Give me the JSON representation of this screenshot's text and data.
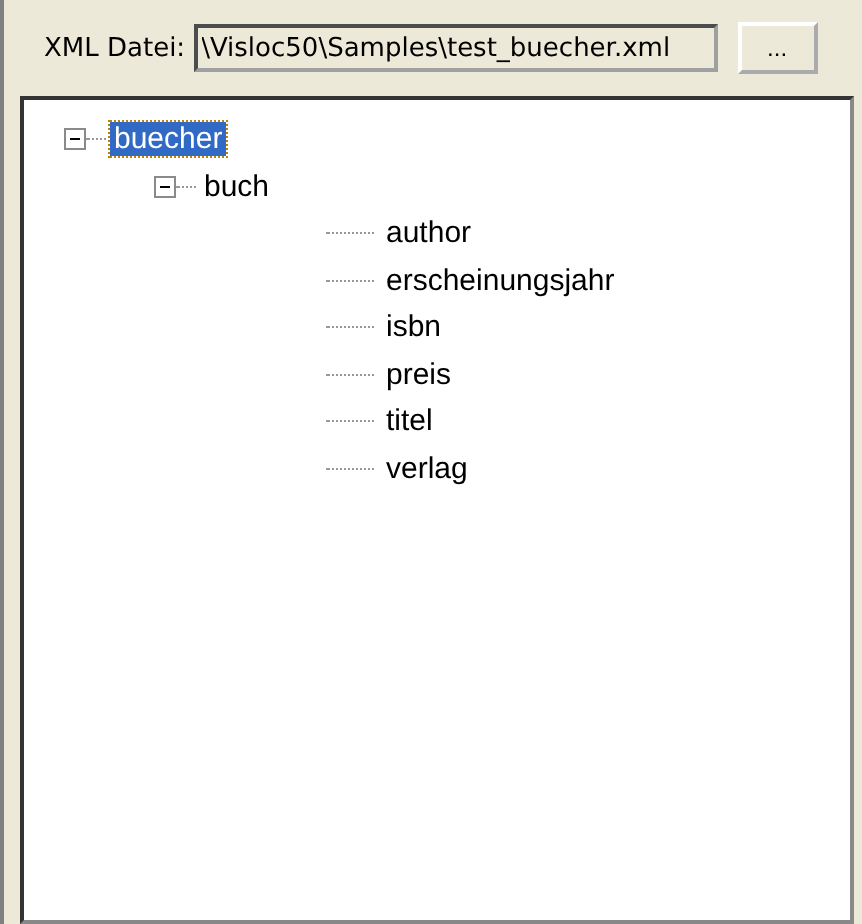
{
  "file_bar": {
    "label": "XML Datei:",
    "value": "\\Visloc50\\Samples\\test_buecher.xml",
    "browse_button": "..."
  },
  "tree": [
    {
      "label": "buecher",
      "selected": true,
      "expanded": true,
      "children": [
        {
          "label": "buch",
          "selected": false,
          "expanded": true,
          "children": [
            {
              "label": "author",
              "selected": false
            },
            {
              "label": "erscheinungsjahr",
              "selected": false
            },
            {
              "label": "isbn",
              "selected": false
            },
            {
              "label": "preis",
              "selected": false
            },
            {
              "label": "titel",
              "selected": false
            },
            {
              "label": "verlag",
              "selected": false
            }
          ]
        }
      ]
    }
  ]
}
